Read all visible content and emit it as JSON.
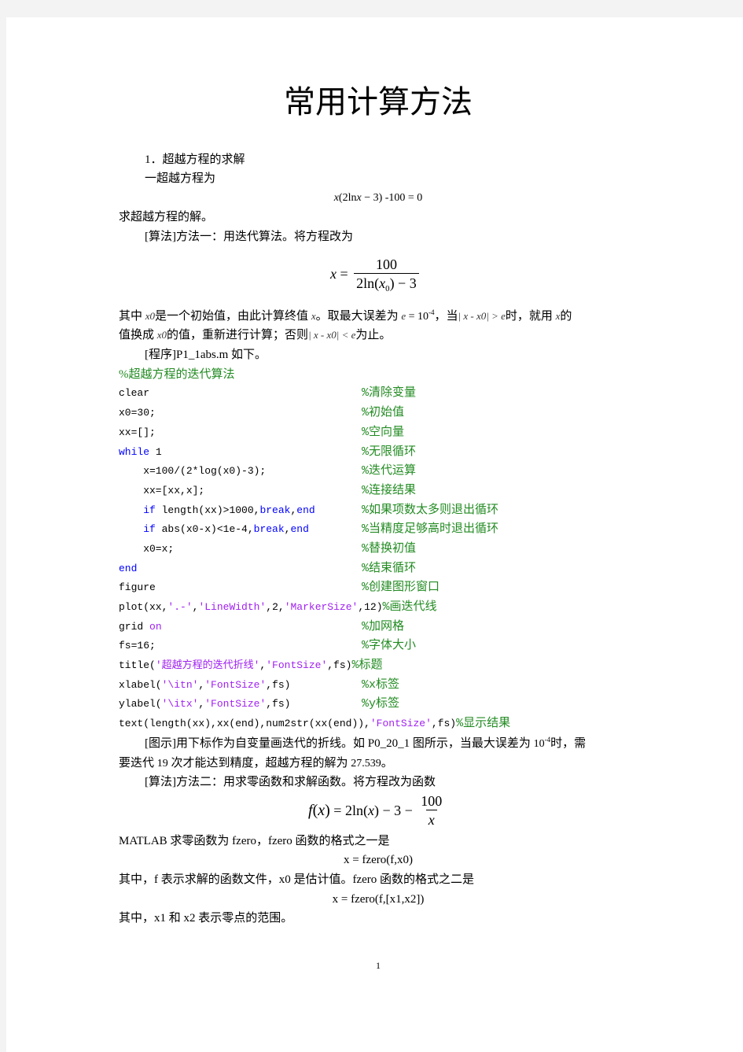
{
  "document": {
    "title": "常用计算方法",
    "page_number": "1"
  },
  "section": {
    "heading": "1．超越方程的求解",
    "intro": "一超越方程为",
    "equation": [
      {
        "style": "var",
        "text": "x"
      },
      {
        "style": "text",
        "text": "(2ln"
      },
      {
        "style": "var",
        "text": "x"
      },
      {
        "style": "text",
        "text": " − 3) -100 = 0"
      }
    ],
    "task": "求超越方程的解。",
    "method1_intro": "[算法]方法一：用迭代算法。将方程改为",
    "iteration_formula": {
      "lhs": [
        {
          "style": "var",
          "text": "x"
        }
      ],
      "equals": " = ",
      "numerator": "100",
      "denominator": [
        {
          "style": "text",
          "text": "2ln("
        },
        {
          "style": "var",
          "text": "x"
        },
        {
          "style": "sub",
          "text": "0"
        },
        {
          "style": "text",
          "text": ") − 3"
        }
      ]
    },
    "explanation_lines": [
      [
        {
          "style": "text",
          "text": "其中 "
        },
        {
          "style": "math",
          "text": "x0"
        },
        {
          "style": "text",
          "text": "是一个初始值，由此计算终值 "
        },
        {
          "style": "math",
          "text": "x"
        },
        {
          "style": "text",
          "text": "。取最大误差为 "
        },
        {
          "style": "math",
          "text": "e"
        },
        {
          "style": "num",
          "text": " = 10"
        },
        {
          "style": "sup",
          "text": "-4"
        },
        {
          "style": "text",
          "text": "，当"
        },
        {
          "style": "math",
          "text": "| x - x0| > e"
        },
        {
          "style": "text",
          "text": "时，就用 "
        },
        {
          "style": "math",
          "text": "x"
        },
        {
          "style": "text",
          "text": "的"
        }
      ],
      [
        {
          "style": "text",
          "text": "值换成 "
        },
        {
          "style": "math",
          "text": "x0"
        },
        {
          "style": "text",
          "text": "的值，重新进行计算；否则"
        },
        {
          "style": "math",
          "text": "| x - x0| < e"
        },
        {
          "style": "text",
          "text": "为止。"
        }
      ]
    ],
    "program_intro": "[程序]P1_1abs.m 如下。",
    "code": {
      "header_comment": "%超越方程的迭代算法",
      "lines": [
        {
          "segments": [
            {
              "style": "code",
              "text": "clear"
            },
            {
              "style": "comment",
              "text": "%清除变量",
              "align": "column"
            }
          ]
        },
        {
          "segments": [
            {
              "style": "code",
              "text": "x0=30;"
            },
            {
              "style": "comment",
              "text": "%初始值",
              "align": "column"
            }
          ]
        },
        {
          "segments": [
            {
              "style": "code",
              "text": "xx=[];"
            },
            {
              "style": "comment",
              "text": "%空向量",
              "align": "column"
            }
          ]
        },
        {
          "segments": [
            {
              "style": "keyword",
              "text": "while"
            },
            {
              "style": "code",
              "text": " 1"
            },
            {
              "style": "comment",
              "text": "%无限循环",
              "align": "column"
            }
          ]
        },
        {
          "segments": [
            {
              "style": "code",
              "text": "    x=100/(2*log(x0)-3);"
            },
            {
              "style": "comment",
              "text": "%迭代运算",
              "align": "column"
            }
          ]
        },
        {
          "segments": [
            {
              "style": "code",
              "text": "    xx=[xx,x];"
            },
            {
              "style": "comment",
              "text": "%连接结果",
              "align": "column"
            }
          ]
        },
        {
          "segments": [
            {
              "style": "code",
              "text": "    "
            },
            {
              "style": "keyword",
              "text": "if"
            },
            {
              "style": "code",
              "text": " length(xx)>1000,"
            },
            {
              "style": "keyword",
              "text": "break"
            },
            {
              "style": "code",
              "text": ","
            },
            {
              "style": "keyword",
              "text": "end"
            },
            {
              "style": "comment",
              "text": "%如果项数太多则退出循环",
              "align": "column"
            }
          ]
        },
        {
          "segments": [
            {
              "style": "code",
              "text": "    "
            },
            {
              "style": "keyword",
              "text": "if"
            },
            {
              "style": "code",
              "text": " abs(x0-x)<1e-4,"
            },
            {
              "style": "keyword",
              "text": "break"
            },
            {
              "style": "code",
              "text": ","
            },
            {
              "style": "keyword",
              "text": "end"
            },
            {
              "style": "comment",
              "text": "%当精度足够高时退出循环",
              "align": "column"
            }
          ]
        },
        {
          "segments": [
            {
              "style": "code",
              "text": "    x0=x;"
            },
            {
              "style": "comment",
              "text": "%替换初值",
              "align": "column"
            }
          ]
        },
        {
          "segments": [
            {
              "style": "keyword",
              "text": "end"
            },
            {
              "style": "comment",
              "text": "%结束循环",
              "align": "column"
            }
          ]
        },
        {
          "segments": [
            {
              "style": "code",
              "text": "figure"
            },
            {
              "style": "comment",
              "text": "%创建图形窗口",
              "align": "column"
            }
          ]
        },
        {
          "segments": [
            {
              "style": "code",
              "text": "plot(xx,"
            },
            {
              "style": "string",
              "text": "'.-'"
            },
            {
              "style": "code",
              "text": ","
            },
            {
              "style": "string",
              "text": "'LineWidth'"
            },
            {
              "style": "code",
              "text": ",2,"
            },
            {
              "style": "string",
              "text": "'MarkerSize'"
            },
            {
              "style": "code",
              "text": ",12)"
            },
            {
              "style": "comment",
              "text": "%画迭代线"
            }
          ]
        },
        {
          "segments": [
            {
              "style": "code",
              "text": "grid "
            },
            {
              "style": "string",
              "text": "on"
            },
            {
              "style": "comment",
              "text": "%加网格",
              "align": "column"
            }
          ]
        },
        {
          "segments": [
            {
              "style": "code",
              "text": "fs=16;"
            },
            {
              "style": "comment",
              "text": "%字体大小",
              "align": "column"
            }
          ]
        },
        {
          "segments": [
            {
              "style": "code",
              "text": "title("
            },
            {
              "style": "string",
              "text": "'超越方程的迭代折线'"
            },
            {
              "style": "code",
              "text": ","
            },
            {
              "style": "string",
              "text": "'FontSize'"
            },
            {
              "style": "code",
              "text": ",fs)"
            },
            {
              "style": "comment",
              "text": "%标题"
            }
          ]
        },
        {
          "segments": [
            {
              "style": "code",
              "text": "xlabel("
            },
            {
              "style": "string",
              "text": "'\\itn'"
            },
            {
              "style": "code",
              "text": ","
            },
            {
              "style": "string",
              "text": "'FontSize'"
            },
            {
              "style": "code",
              "text": ",fs)"
            },
            {
              "style": "comment",
              "text": "%x标签",
              "align": "column"
            }
          ]
        },
        {
          "segments": [
            {
              "style": "code",
              "text": "ylabel("
            },
            {
              "style": "string",
              "text": "'\\itx'"
            },
            {
              "style": "code",
              "text": ","
            },
            {
              "style": "string",
              "text": "'FontSize'"
            },
            {
              "style": "code",
              "text": ",fs)"
            },
            {
              "style": "comment",
              "text": "%y标签",
              "align": "column"
            }
          ]
        },
        {
          "segments": [
            {
              "style": "code",
              "text": "text(length(xx),xx(end),num2str(xx(end)),"
            },
            {
              "style": "string",
              "text": "'FontSize'"
            },
            {
              "style": "code",
              "text": ",fs)"
            },
            {
              "style": "comment",
              "text": "%显示结果"
            }
          ]
        }
      ]
    },
    "figure_note_lines": [
      [
        {
          "style": "text",
          "text": "[图示]用下标作为自变量画迭代的折线。如 P0_20_1 图所示，当最大误差为 "
        },
        {
          "style": "num",
          "text": "10"
        },
        {
          "style": "sup",
          "text": "-4"
        },
        {
          "style": "text",
          "text": "时，需"
        }
      ],
      [
        {
          "style": "text",
          "text": "要迭代 "
        },
        {
          "style": "num",
          "text": "19"
        },
        {
          "style": "text",
          "text": " 次才能达到精度，超越方程的解为 "
        },
        {
          "style": "num",
          "text": "27.539"
        },
        {
          "style": "text",
          "text": "。"
        }
      ]
    ],
    "method2_intro": "[算法]方法二：用求零函数和求解函数。将方程改为函数",
    "function_formula": {
      "lhs": [
        {
          "style": "var",
          "text": "f"
        },
        {
          "style": "text",
          "text": "("
        },
        {
          "style": "var",
          "text": "x"
        },
        {
          "style": "text",
          "text": ")"
        }
      ],
      "equals": " = ",
      "rhs": [
        {
          "style": "text",
          "text": "2ln("
        },
        {
          "style": "var",
          "text": "x"
        },
        {
          "style": "text",
          "text": ") − 3 − "
        }
      ],
      "numerator": "100",
      "denominator": [
        {
          "style": "var",
          "text": "x"
        }
      ]
    },
    "fzero_intro": "MATLAB 求零函数为 fzero，fzero 函数的格式之一是",
    "fzero_form1": "x = fzero(f,x0)",
    "fzero_note": "其中，f 表示求解的函数文件，x0 是估计值。fzero 函数的格式之二是",
    "fzero_form2": "x = fzero(f,[x1,x2])",
    "range_note": "其中，x1 和 x2 表示零点的范围。"
  },
  "syntax_colors": {
    "comment": "#228B22",
    "keyword": "#0000FF",
    "string": "#A020F0",
    "plain": "#000000"
  }
}
